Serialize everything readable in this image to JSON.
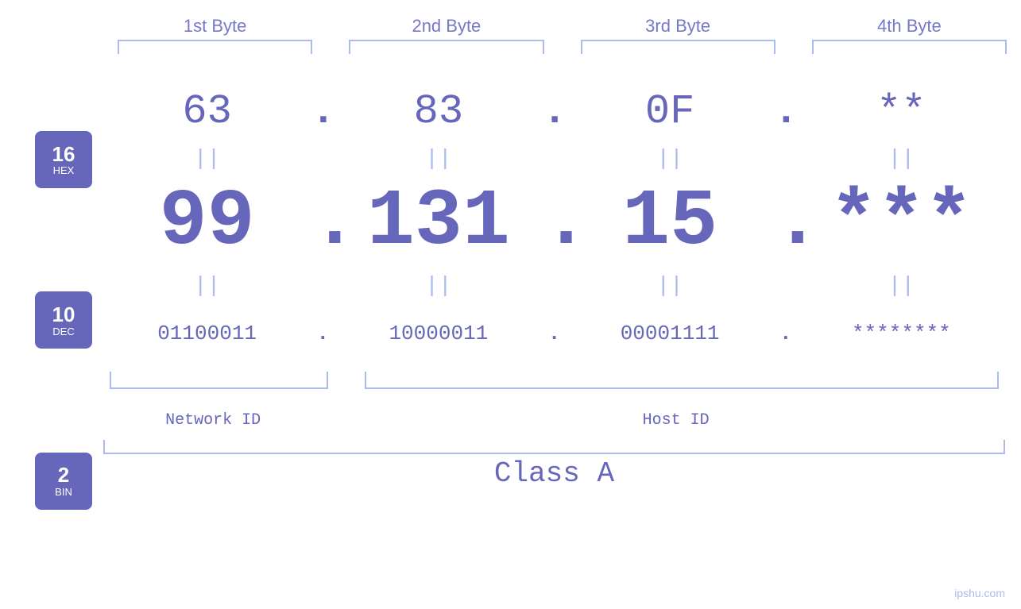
{
  "header": {
    "byte1_label": "1st Byte",
    "byte2_label": "2nd Byte",
    "byte3_label": "3rd Byte",
    "byte4_label": "4th Byte"
  },
  "badges": {
    "hex": {
      "num": "16",
      "base": "HEX"
    },
    "dec": {
      "num": "10",
      "base": "DEC"
    },
    "bin": {
      "num": "2",
      "base": "BIN"
    }
  },
  "hex_row": {
    "b1": "63",
    "b2": "83",
    "b3": "0F",
    "b4": "**",
    "dots": [
      ".",
      ".",
      "."
    ]
  },
  "dec_row": {
    "b1": "99",
    "b2": "131",
    "b3": "15",
    "b4": "***",
    "dots": [
      ".",
      ".",
      "."
    ]
  },
  "bin_row": {
    "b1": "01100011",
    "b2": "10000011",
    "b3": "00001111",
    "b4": "********",
    "dots": [
      ".",
      ".",
      "."
    ]
  },
  "equals": "||",
  "labels": {
    "network_id": "Network ID",
    "host_id": "Host ID",
    "class": "Class A"
  },
  "watermark": "ipshu.com"
}
